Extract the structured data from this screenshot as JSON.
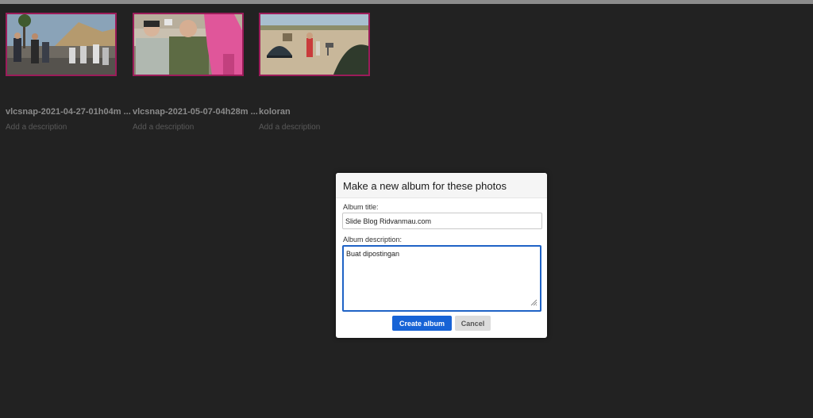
{
  "gallery": {
    "photos": [
      {
        "filename": "vlcsnap-2021-04-27-01h04m ...",
        "description_placeholder": "Add a description",
        "thumb_icon": "photo-thumbnail"
      },
      {
        "filename": "vlcsnap-2021-05-07-04h28m ...",
        "description_placeholder": "Add a description",
        "thumb_icon": "photo-thumbnail"
      },
      {
        "filename": "koloran",
        "description_placeholder": "Add a description",
        "thumb_icon": "photo-thumbnail"
      }
    ]
  },
  "dialog": {
    "title": "Make a new album for these photos",
    "album_title_label": "Album title:",
    "album_title_value": "Slide Blog Ridvanmau.com",
    "album_description_label": "Album description:",
    "album_description_value": "Buat dipostingan",
    "create_button": "Create album",
    "cancel_button": "Cancel"
  },
  "colors": {
    "background": "#222222",
    "thumb_border": "#9c1c5a",
    "primary_button": "#1763d6",
    "focus_border": "#1f63c6"
  }
}
